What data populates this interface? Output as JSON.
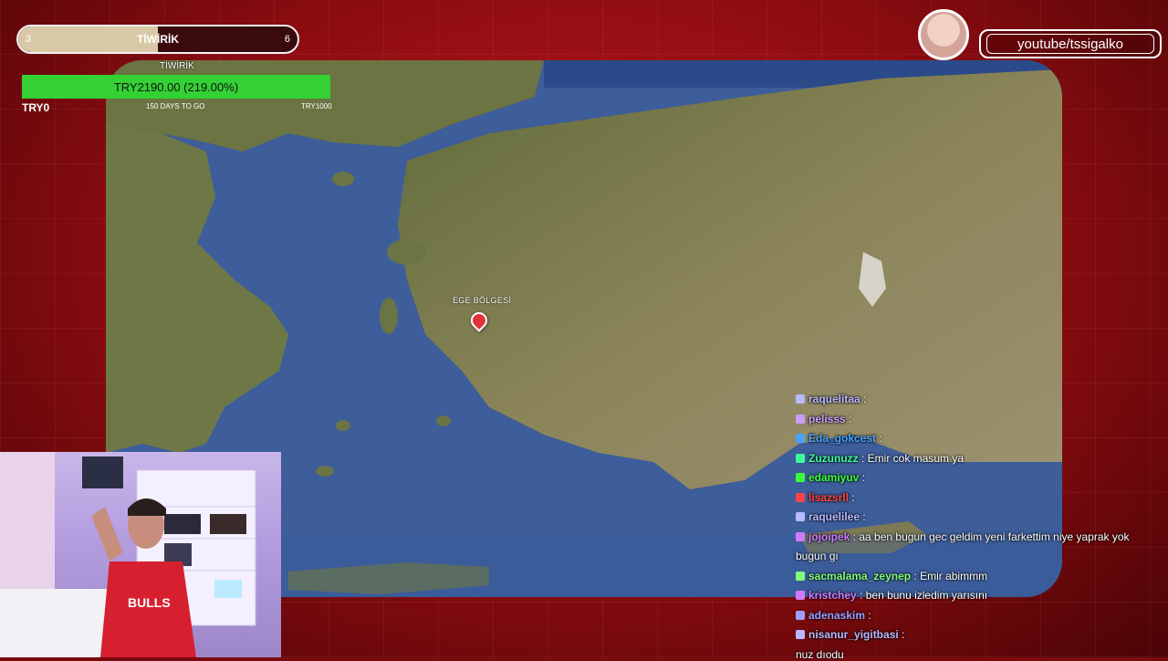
{
  "goal": {
    "label": "TİWİRİK",
    "current": "3",
    "target": "6",
    "progress_fraction": 0.5
  },
  "donation": {
    "title": "TİWİRİK",
    "amount": "TRY2190.00 (219.00%)",
    "low": "TRY0",
    "days": "150 DAYS TO GO",
    "high": "TRY1000",
    "fill_fraction": 1.0,
    "fill_color": "#34d134"
  },
  "map": {
    "pin_label": "EGE BÖLGESİ",
    "pin_color": "#e0343b"
  },
  "branding": {
    "handle": "youtube/tssigalko"
  },
  "chat": {
    "messages": [
      {
        "user": "raquelitaa",
        "text": ":",
        "color": "#b9b9ff"
      },
      {
        "user": "pelisss",
        "text": ":",
        "color": "#c9a0ff"
      },
      {
        "user": "Eda_gokcest",
        "text": ":",
        "color": "#4aa3ff"
      },
      {
        "user": "Zuzunuzz",
        "text": ": Emir cok masum ya",
        "color": "#3cff9d"
      },
      {
        "user": "edamiyuv",
        "text": ":",
        "color": "#3cff3c"
      },
      {
        "user": "lisazsrll",
        "text": ":",
        "color": "#ff4444"
      },
      {
        "user": "raquelilee",
        "text": ":",
        "color": "#b9b9ff"
      },
      {
        "user": "jojoipek",
        "text": ": aa ben bugun gec geldim yeni farkettim niye yaprak yok",
        "color": "#d07bff"
      },
      {
        "user": "",
        "text": "bugun gı",
        "color": "#ffffff"
      },
      {
        "user": "sacmalama_zeynep",
        "text": ": Emir abimmm",
        "color": "#7fff7f"
      },
      {
        "user": "kristchey",
        "text": ": ben bunu izledim yarısını",
        "color": "#d07bff"
      },
      {
        "user": "adenaskim",
        "text": ":",
        "color": "#9f9fff"
      },
      {
        "user": "nisanur_yigitbasi",
        "text": ":",
        "color": "#b9b9ff"
      },
      {
        "user": "",
        "text": "nuz dıodu",
        "color": "#ffffff"
      }
    ]
  }
}
